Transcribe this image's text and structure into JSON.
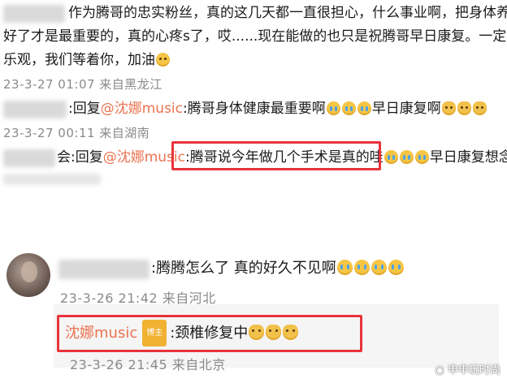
{
  "comments": [
    {
      "line1": "作为腾哥的忠实粉丝，真的这几天都一直很担心，什么事业啊，把身体养",
      "line2": "好了才是最重要的，真的心疼s了，哎......现在能做的也只是祝腾哥早日康复。一定要",
      "line3": "乐观，我们等着你，加油",
      "meta": "23-3-27 01:07 来自黑龙江"
    },
    {
      "reply_prefix": ":回复",
      "mention": "@沈娜music",
      "text": ":腾哥身体健康最重要啊",
      "text2": "早日康复啊",
      "meta": "23-3-27 00:11 来自湖南"
    },
    {
      "reply_prefix": "会:回复",
      "mention": "@沈娜music",
      "sep": ":",
      "highlight": "腾哥说今年做几个手术是真的哇",
      "text2": "早日康复想念"
    }
  ],
  "thread": {
    "comment_text": ":腾腾怎么了 真的好久不见啊",
    "comment_meta": "23-3-26 21:42 来自河北",
    "reply_user": "沈娜music",
    "reply_badge": "博主",
    "reply_text": ":颈椎修复中",
    "reply_meta": "23-3-26 21:45 来自北京"
  },
  "watermark": "申申玩时尚",
  "colors": {
    "highlight_box": "#e8333a",
    "mention": "#eb7350",
    "meta": "#8a8a8a"
  },
  "icons": [
    "cry-emoji-icon",
    "pray-emoji-icon",
    "kiss-emoji-icon",
    "weibo-icon"
  ]
}
